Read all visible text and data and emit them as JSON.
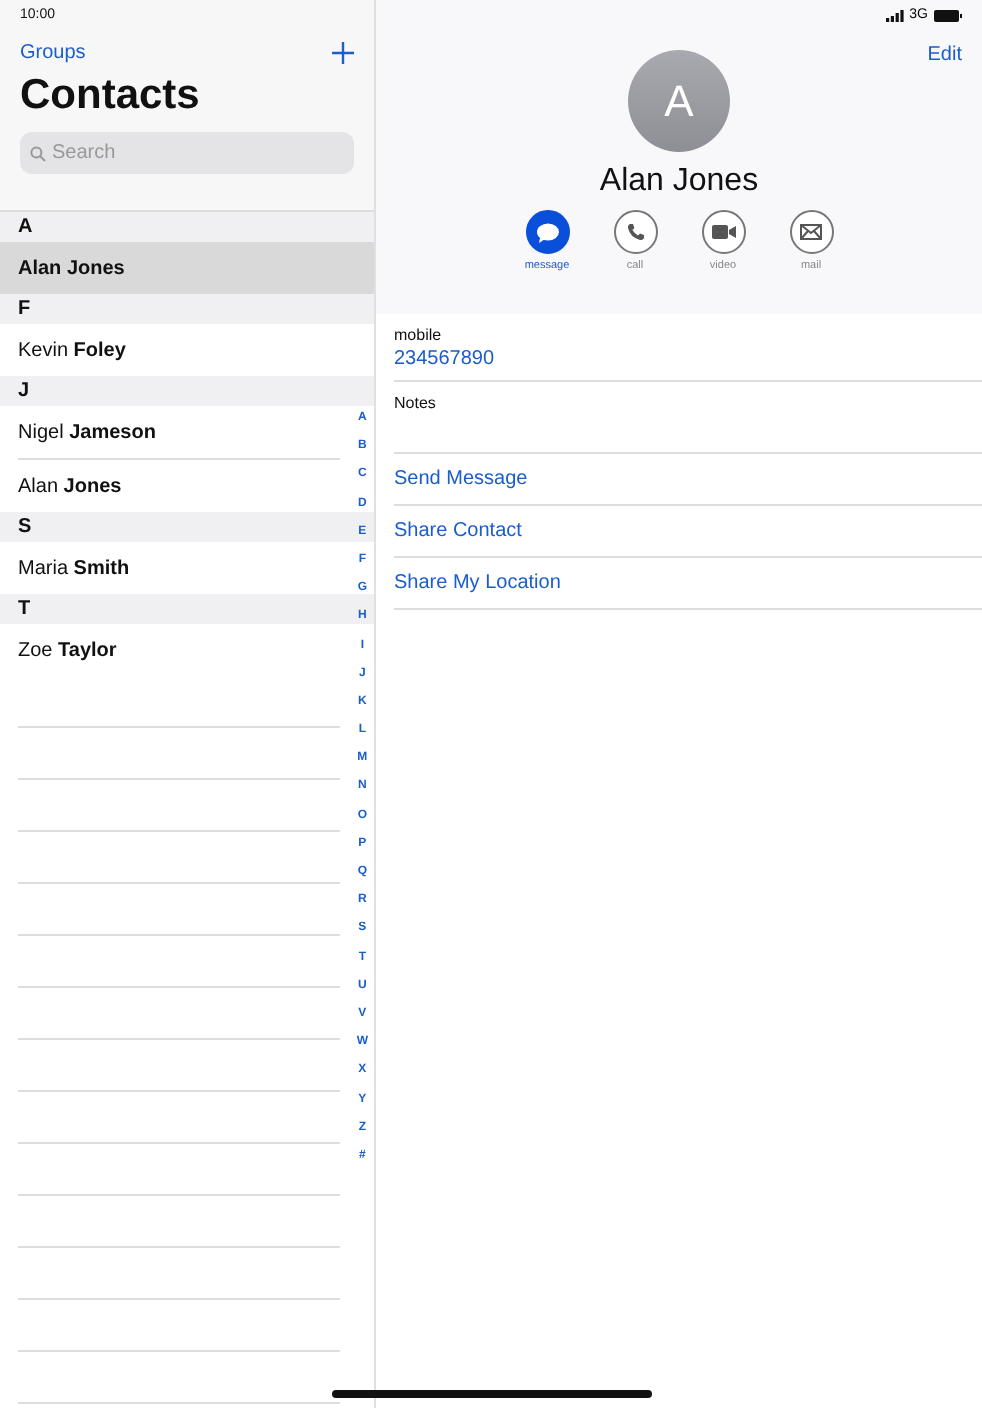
{
  "status_bar": {
    "time": "10:00",
    "network": "3G"
  },
  "sidebar": {
    "groups_link": "Groups",
    "title": "Contacts",
    "search": {
      "placeholder": "Search"
    },
    "sections": [
      {
        "letter": "A",
        "contacts": [
          {
            "name": "Alan Jones",
            "selected": true
          }
        ]
      },
      {
        "letter": "F",
        "contacts": [
          {
            "name": "Kevin **Foley**",
            "selected": false
          }
        ]
      },
      {
        "letter": "J",
        "contacts": [
          {
            "name": "Nigel **Jameson**",
            "selected": false
          },
          {
            "name": "Alan **Jones**",
            "selected": false
          }
        ]
      },
      {
        "letter": "S",
        "contacts": [
          {
            "name": "Maria **Smith**",
            "selected": false
          }
        ]
      },
      {
        "letter": "T",
        "contacts": [
          {
            "name": "Zoe **Taylor**",
            "selected": false
          }
        ]
      }
    ],
    "index": [
      "A",
      "B",
      "C",
      "D",
      "E",
      "F",
      "G",
      "H",
      "I",
      "J",
      "K",
      "L",
      "M",
      "N",
      "O",
      "P",
      "Q",
      "R",
      "S",
      "T",
      "U",
      "V",
      "W",
      "X",
      "Y",
      "Z",
      "#"
    ]
  },
  "detail": {
    "edit": "Edit",
    "avatar": "A",
    "name": "Alan Jones",
    "actions": [
      {
        "kind": "message",
        "label": "message",
        "selected": true
      },
      {
        "kind": "call",
        "label": "call",
        "selected": false
      },
      {
        "kind": "video",
        "label": "video",
        "selected": false
      },
      {
        "kind": "mail",
        "label": "mail",
        "selected": false
      }
    ],
    "phone": {
      "label": "mobile",
      "value": "234567890"
    },
    "notes": {
      "label": "Notes"
    },
    "links": [
      "Send Message",
      "Share Contact",
      "Share My Location"
    ]
  }
}
